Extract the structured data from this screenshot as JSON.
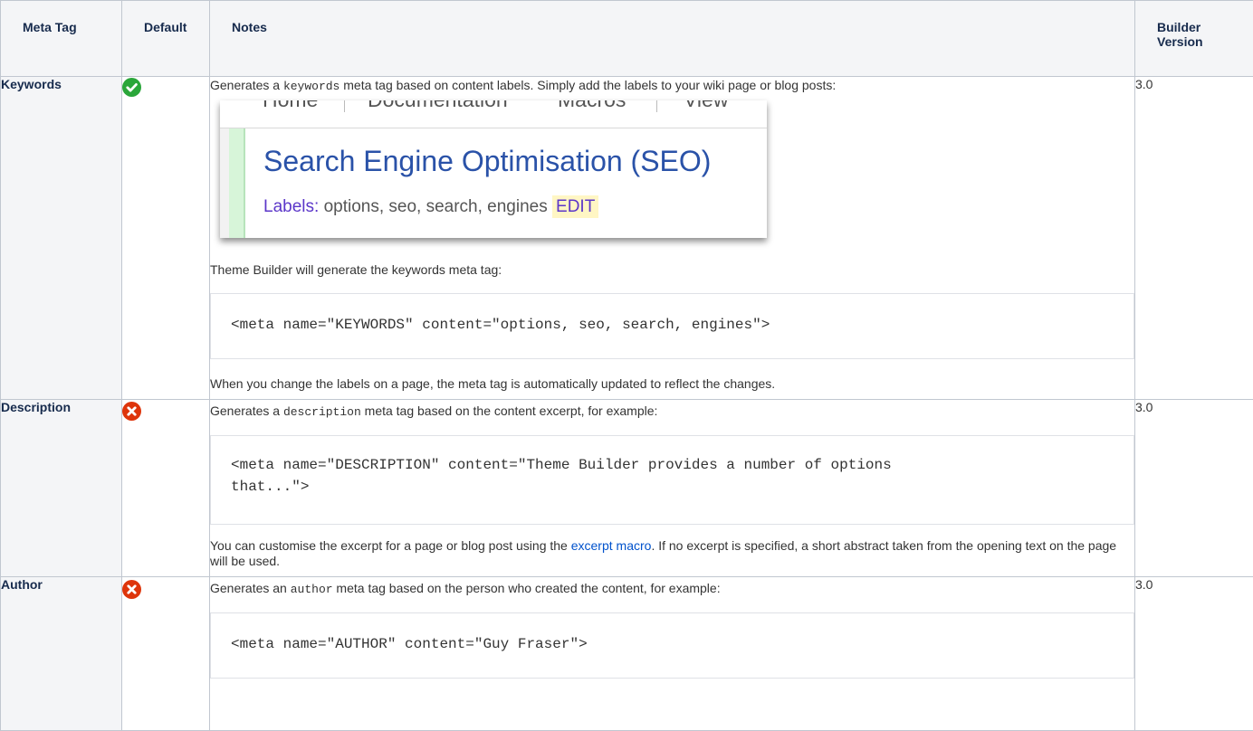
{
  "table": {
    "headers": {
      "meta_tag": "Meta Tag",
      "default": "Default",
      "notes": "Notes",
      "builder_version": "Builder Version"
    },
    "rows": [
      {
        "meta_tag": "Keywords",
        "default_status": "enabled",
        "default_icon": "check-circle-icon",
        "version": "3.0",
        "intro_prefix": "Generates a ",
        "intro_code": "keywords",
        "intro_suffix": " meta tag based on content labels. Simply add the labels to your wiki page or blog posts:",
        "screenshot": {
          "menu": [
            "Home",
            "Documentation",
            "Macros",
            "View"
          ],
          "title": "Search Engine Optimisation (SEO)",
          "labels_key": "Labels:",
          "labels_values": "options, seo, search, engines",
          "edit": "EDIT"
        },
        "after_shot": "Theme Builder will generate the keywords meta tag:",
        "code": "<meta name=\"KEYWORDS\" content=\"options, seo, search, engines\">",
        "footer": "When you change the labels on a page, the meta tag is automatically updated to reflect the changes."
      },
      {
        "meta_tag": "Description",
        "default_status": "disabled",
        "default_icon": "x-circle-icon",
        "version": "3.0",
        "intro_prefix": "Generates a ",
        "intro_code": "description",
        "intro_suffix": " meta tag based on the content excerpt, for example:",
        "code_line1": "<meta name=\"DESCRIPTION\" content=\"Theme Builder provides a number of options",
        "code_line2": "that...\">",
        "footer_prefix": "You can customise the excerpt for a page or blog post using the ",
        "footer_link": "excerpt macro",
        "footer_suffix": ". If no excerpt is specified, a short abstract taken from the opening text on the page will be used."
      },
      {
        "meta_tag": "Author",
        "default_status": "disabled",
        "default_icon": "x-circle-icon",
        "version": "3.0",
        "intro_prefix": "Generates an ",
        "intro_code": "author",
        "intro_suffix": " meta tag based on the person who created the content, for example:",
        "code": "<meta name=\"AUTHOR\" content=\"Guy Fraser\">"
      }
    ]
  },
  "colors": {
    "enabled": "#2aa63a",
    "disabled": "#de350b",
    "link": "#0052cc",
    "header_bg": "#f4f5f7"
  }
}
